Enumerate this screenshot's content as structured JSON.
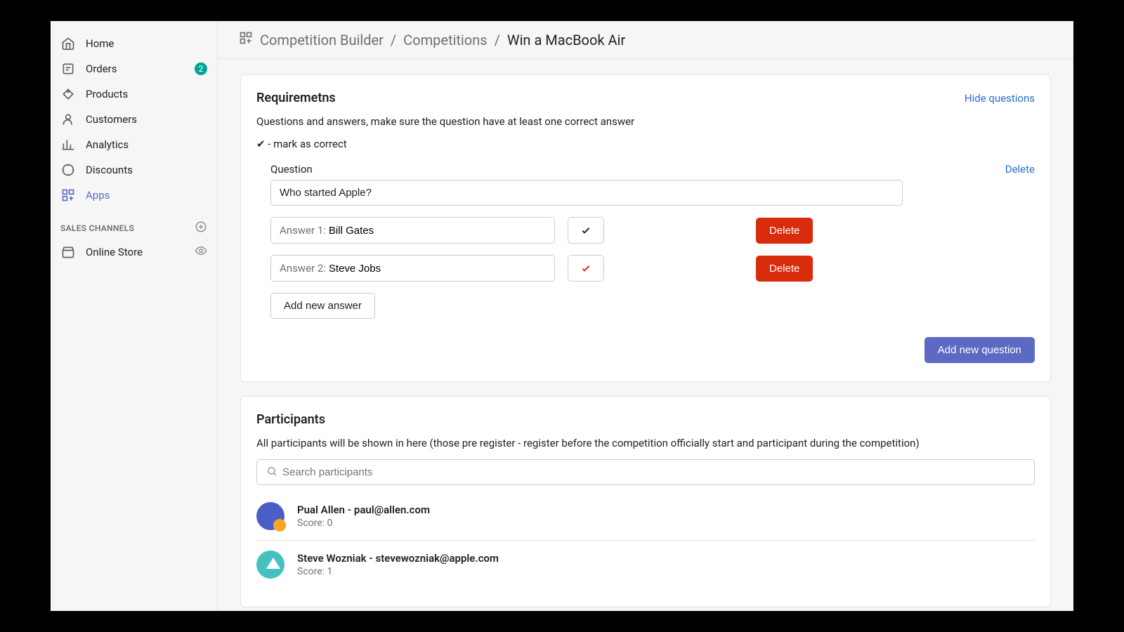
{
  "sidebar": {
    "items": [
      {
        "label": "Home"
      },
      {
        "label": "Orders",
        "badge": "2"
      },
      {
        "label": "Products"
      },
      {
        "label": "Customers"
      },
      {
        "label": "Analytics"
      },
      {
        "label": "Discounts"
      },
      {
        "label": "Apps"
      }
    ],
    "section_header": "SALES CHANNELS",
    "channels": [
      {
        "label": "Online Store"
      }
    ]
  },
  "breadcrumb": {
    "part1": "Competition Builder",
    "part2": "Competitions",
    "current": "Win a MacBook Air"
  },
  "requirements": {
    "title": "Requiremetns",
    "hide_link": "Hide questions",
    "description": "Questions and answers, make sure the question have at least one correct answer",
    "mark_note": "✔ - mark as correct",
    "question_label": "Question",
    "delete_label": "Delete",
    "question_value": "Who started Apple?",
    "answers": [
      {
        "prefix": "Answer 1: ",
        "value": "Bill Gates",
        "correct": false,
        "delete_label": "Delete"
      },
      {
        "prefix": "Answer 2: ",
        "value": "Steve Jobs",
        "correct": true,
        "delete_label": "Delete"
      }
    ],
    "add_answer_label": "Add new answer",
    "add_question_label": "Add new question"
  },
  "participants": {
    "title": "Participants",
    "description": "All participants will be shown in here (those pre register - register before the competition officially start and participant during the competition)",
    "search_placeholder": "Search participants",
    "items": [
      {
        "title": "Pual Allen - paul@allen.com",
        "score": "Score: 0"
      },
      {
        "title": "Steve Wozniak - stevewozniak@apple.com",
        "score": "Score: 1"
      }
    ]
  }
}
